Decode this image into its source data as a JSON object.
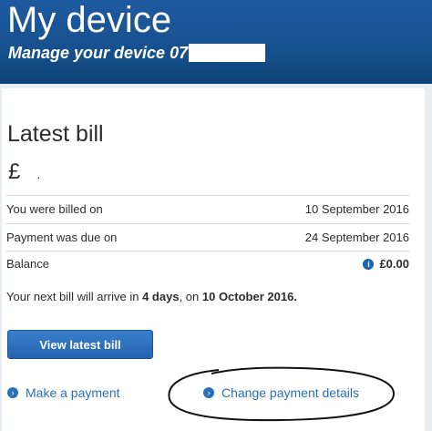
{
  "header": {
    "title": "My device",
    "subtitle": "Manage your device 07"
  },
  "bill": {
    "title": "Latest bill",
    "currency_symbol": "£",
    "currency_dot": ".",
    "rows": [
      {
        "label": "You were billed on",
        "value": "10 September 2016"
      },
      {
        "label": "Payment was due on",
        "value": "24 September 2016"
      },
      {
        "label": "Balance",
        "value": "£0.00"
      }
    ],
    "next_bill": {
      "prefix": "Your next bill will arrive in ",
      "days": "4 days",
      "middle": ", on ",
      "date": "10 October 2016."
    },
    "view_button": "View latest bill"
  },
  "links": {
    "make_payment": "Make a payment",
    "change_payment": "Change payment details"
  },
  "colors": {
    "header_blue": "#17518f",
    "link_blue": "#2a6fb7",
    "button_blue": "#2464ad"
  },
  "icons": [
    "info-icon",
    "chevron-right-icon"
  ]
}
